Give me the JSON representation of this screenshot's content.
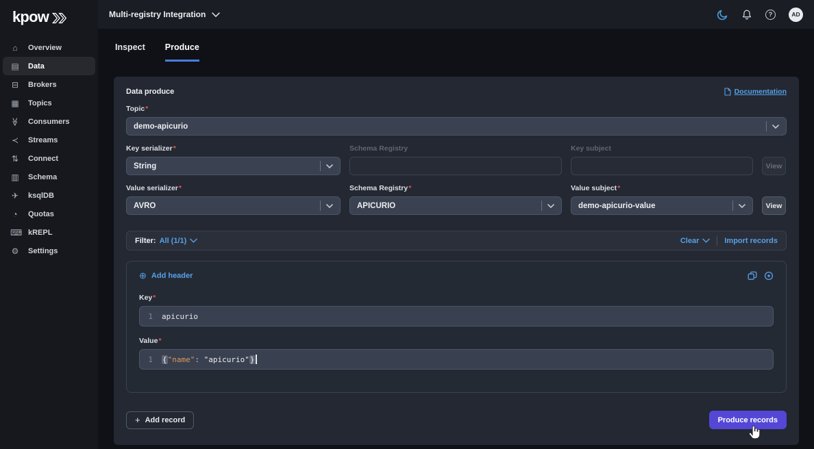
{
  "brand": {
    "name": "kpow"
  },
  "topbar": {
    "context_selector": "Multi-registry Integration",
    "avatar_initials": "AD",
    "help_glyph": "?",
    "icons": [
      "moon-icon",
      "bell-icon",
      "help-icon",
      "avatar"
    ]
  },
  "sidebar": {
    "items": [
      {
        "label": "Overview",
        "icon": "home",
        "glyph": "⌂"
      },
      {
        "label": "Data",
        "icon": "file",
        "glyph": "▤"
      },
      {
        "label": "Brokers",
        "icon": "drive",
        "glyph": "⊟"
      },
      {
        "label": "Topics",
        "icon": "table",
        "glyph": "▦"
      },
      {
        "label": "Consumers",
        "icon": "double-chevron",
        "glyph": "≫"
      },
      {
        "label": "Streams",
        "icon": "share",
        "glyph": "≺"
      },
      {
        "label": "Connect",
        "icon": "sort-arrows",
        "glyph": "⇅"
      },
      {
        "label": "Schema",
        "icon": "document",
        "glyph": "▥"
      },
      {
        "label": "ksqlDB",
        "icon": "rocket",
        "glyph": "✈"
      },
      {
        "label": "Quotas",
        "icon": "pie-chart",
        "glyph": "◔"
      },
      {
        "label": "kREPL",
        "icon": "terminal",
        "glyph": "⌨"
      },
      {
        "label": "Settings",
        "icon": "gear",
        "glyph": "⚙"
      }
    ]
  },
  "tabs": {
    "inspect": "Inspect",
    "produce": "Produce"
  },
  "form": {
    "title": "Data produce",
    "documentation_label": "Documentation",
    "topic": {
      "label": "Topic",
      "value": "demo-apicurio"
    },
    "key_serializer": {
      "label": "Key serializer",
      "value": "String"
    },
    "key_schema_registry": {
      "label": "Schema Registry",
      "value": ""
    },
    "key_subject": {
      "label": "Key subject",
      "value": "",
      "view_label": "View"
    },
    "value_serializer": {
      "label": "Value serializer",
      "value": "AVRO"
    },
    "value_schema_registry": {
      "label": "Schema Registry",
      "value": "APICURIO"
    },
    "value_subject": {
      "label": "Value subject",
      "value": "demo-apicurio-value",
      "view_label": "View"
    }
  },
  "filter_bar": {
    "filter_label": "Filter:",
    "filter_value": "All (1/1)",
    "clear_label": "Clear",
    "import_label": "Import records"
  },
  "record": {
    "add_header_label": "Add header",
    "add_header_glyph": "⊕",
    "key": {
      "label": "Key",
      "line_number": "1",
      "code": "apicurio"
    },
    "value": {
      "label": "Value",
      "line_number": "1",
      "tokens": {
        "open": "{",
        "name": "\"name\"",
        "sep": ": ",
        "value": "\"apicurio\"",
        "close": "}"
      }
    }
  },
  "actions": {
    "add_record_label": "Add record",
    "add_record_glyph": "+",
    "produce_label": "Produce records"
  },
  "misc": {
    "required_marker": "*"
  },
  "colors": {
    "accent_blue": "#58a0e8",
    "primary_purple": "#5447d6",
    "required_red": "#e25555",
    "code_orange": "#d99a5b",
    "card_bg": "#232832",
    "sidebar_bg": "#16181e"
  }
}
